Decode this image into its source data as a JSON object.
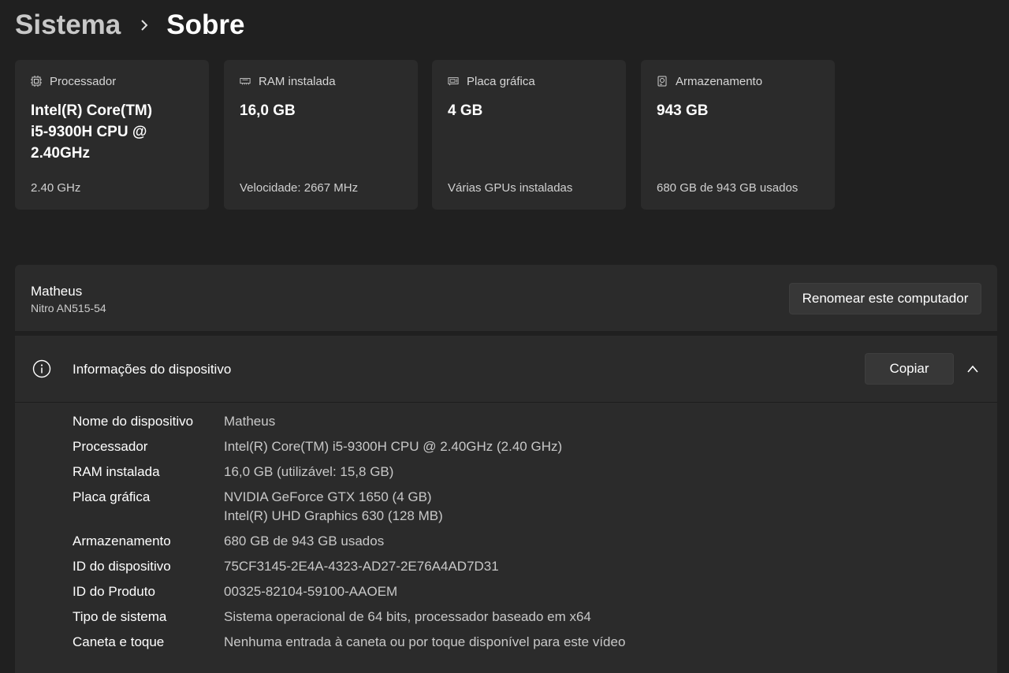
{
  "breadcrumb": {
    "parent": "Sistema",
    "current": "Sobre"
  },
  "cards": [
    {
      "icon": "processor-chip-icon",
      "title": "Processador",
      "value": "Intel(R) Core(TM)\ni5-9300H CPU @\n2.40GHz",
      "sub": "2.40 GHz"
    },
    {
      "icon": "ram-memory-icon",
      "title": "RAM instalada",
      "value": "16,0 GB",
      "sub": "Velocidade: 2667 MHz"
    },
    {
      "icon": "graphics-card-icon",
      "title": "Placa gráfica",
      "value": "4 GB",
      "sub": "Várias GPUs instaladas"
    },
    {
      "icon": "storage-drive-icon",
      "title": "Armazenamento",
      "value": "943 GB",
      "sub": "680 GB de 943 GB usados"
    }
  ],
  "computer": {
    "name": "Matheus",
    "model": "Nitro AN515-54",
    "rename_label": "Renomear este computador"
  },
  "device_info": {
    "title": "Informações do dispositivo",
    "copy_label": "Copiar",
    "rows": [
      {
        "label": "Nome do dispositivo",
        "values": [
          "Matheus"
        ]
      },
      {
        "label": "Processador",
        "values": [
          "Intel(R) Core(TM) i5-9300H CPU @ 2.40GHz (2.40 GHz)"
        ]
      },
      {
        "label": "RAM instalada",
        "values": [
          "16,0 GB (utilizável: 15,8 GB)"
        ]
      },
      {
        "label": "Placa gráfica",
        "values": [
          "NVIDIA GeForce GTX 1650 (4 GB)",
          "Intel(R) UHD Graphics 630 (128 MB)"
        ]
      },
      {
        "label": "Armazenamento",
        "values": [
          "680 GB de 943 GB usados"
        ]
      },
      {
        "label": "ID do dispositivo",
        "values": [
          "75CF3145-2E4A-4323-AD27-2E76A4AD7D31"
        ]
      },
      {
        "label": "ID do Produto",
        "values": [
          "00325-82104-59100-AAOEM"
        ]
      },
      {
        "label": "Tipo de sistema",
        "values": [
          "Sistema operacional de 64 bits, processador baseado em x64"
        ]
      },
      {
        "label": "Caneta e toque",
        "values": [
          "Nenhuma entrada à caneta ou por toque disponível para este vídeo"
        ]
      }
    ]
  },
  "colors": {
    "background": "#202020",
    "card": "#2b2b2b",
    "button": "#373737",
    "secondary_text": "#c8c8c8"
  }
}
